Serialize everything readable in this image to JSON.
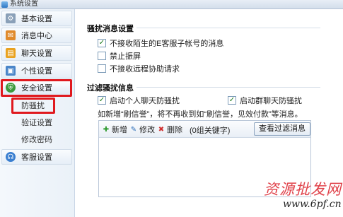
{
  "window": {
    "title": "系统设置"
  },
  "sidebar": {
    "items": [
      {
        "label": "基本设置",
        "icon": "gear-icon"
      },
      {
        "label": "消息中心",
        "icon": "envelope-icon"
      },
      {
        "label": "聊天设置",
        "icon": "chat-icon"
      },
      {
        "label": "个性设置",
        "icon": "window-icon"
      },
      {
        "label": "安全设置",
        "icon": "shield-icon"
      },
      {
        "label": "客服设置",
        "icon": "headset-icon"
      }
    ],
    "security_subitems": [
      "防骚扰",
      "验证设置",
      "修改密码"
    ],
    "selected_item": "安全设置",
    "selected_subitem": "防骚扰"
  },
  "harassment": {
    "title": "骚扰消息设置",
    "options": [
      {
        "label": "不接收陌生的E客服子帐号的消息",
        "checked": true
      },
      {
        "label": "禁止振屏",
        "checked": false
      },
      {
        "label": "不接收远程协助请求",
        "checked": false
      }
    ]
  },
  "filter": {
    "title": "过滤骚扰信息",
    "options": [
      {
        "label": "启动个人聊天防骚扰",
        "checked": true
      },
      {
        "label": "启动群聊天防骚扰",
        "checked": true
      }
    ],
    "hint": "如新增“刷信誉”，将不再收到如“刷信誉，见效付款”等消息。",
    "toolbar": {
      "add_label": "新增",
      "edit_label": "修改",
      "delete_label": "删除",
      "keyword_count": "(0组关键字)",
      "view_label": "查看过滤消息"
    }
  },
  "watermark": {
    "text": "资源批发网",
    "url": "www.6pf.cn"
  },
  "colors": {
    "highlight_border": "#e0191e",
    "check_mark": "#1a7a1a",
    "accent": "#2f77c4"
  }
}
